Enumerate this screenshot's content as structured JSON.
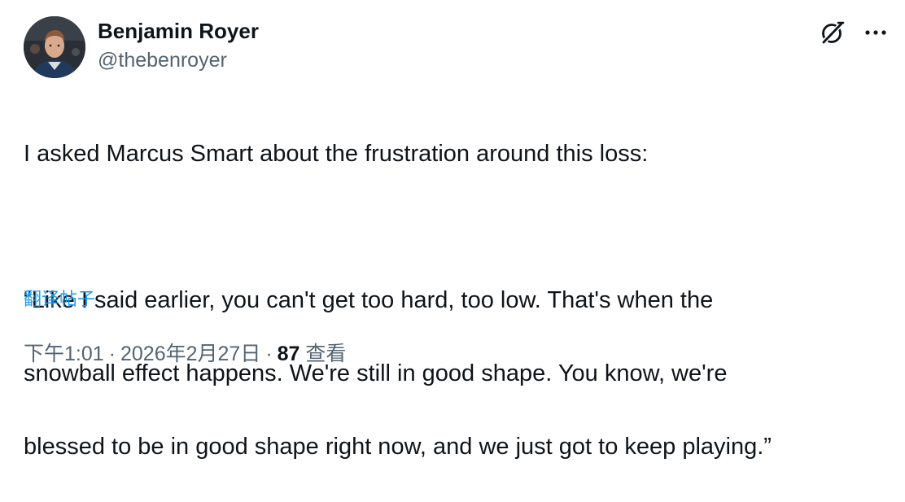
{
  "author": {
    "display_name": "Benjamin Royer",
    "handle": "@thebenroyer",
    "avatar_icon": "profile-photo"
  },
  "header": {
    "grok_icon": "grok-icon",
    "more_icon": "more-horizontal-icon"
  },
  "tweet": {
    "paragraph_1": "I asked Marcus Smart about the frustration around this loss:",
    "line_1": "“Like I said earlier, you can't get too hard, too low. That's when the",
    "line_2": "snowball effect happens. We're still in good shape. You know, we're",
    "line_3": "blessed to be in good shape right now, and we just got to keep playing.”",
    "translate_label": "翻译帖子"
  },
  "meta": {
    "time": "下午1:01",
    "separator": "·",
    "date": "2026年2月27日",
    "views_count": "87",
    "views_label": "查看"
  },
  "colors": {
    "text": "#0f1419",
    "secondary": "#536471",
    "link": "#1d9bf0"
  }
}
